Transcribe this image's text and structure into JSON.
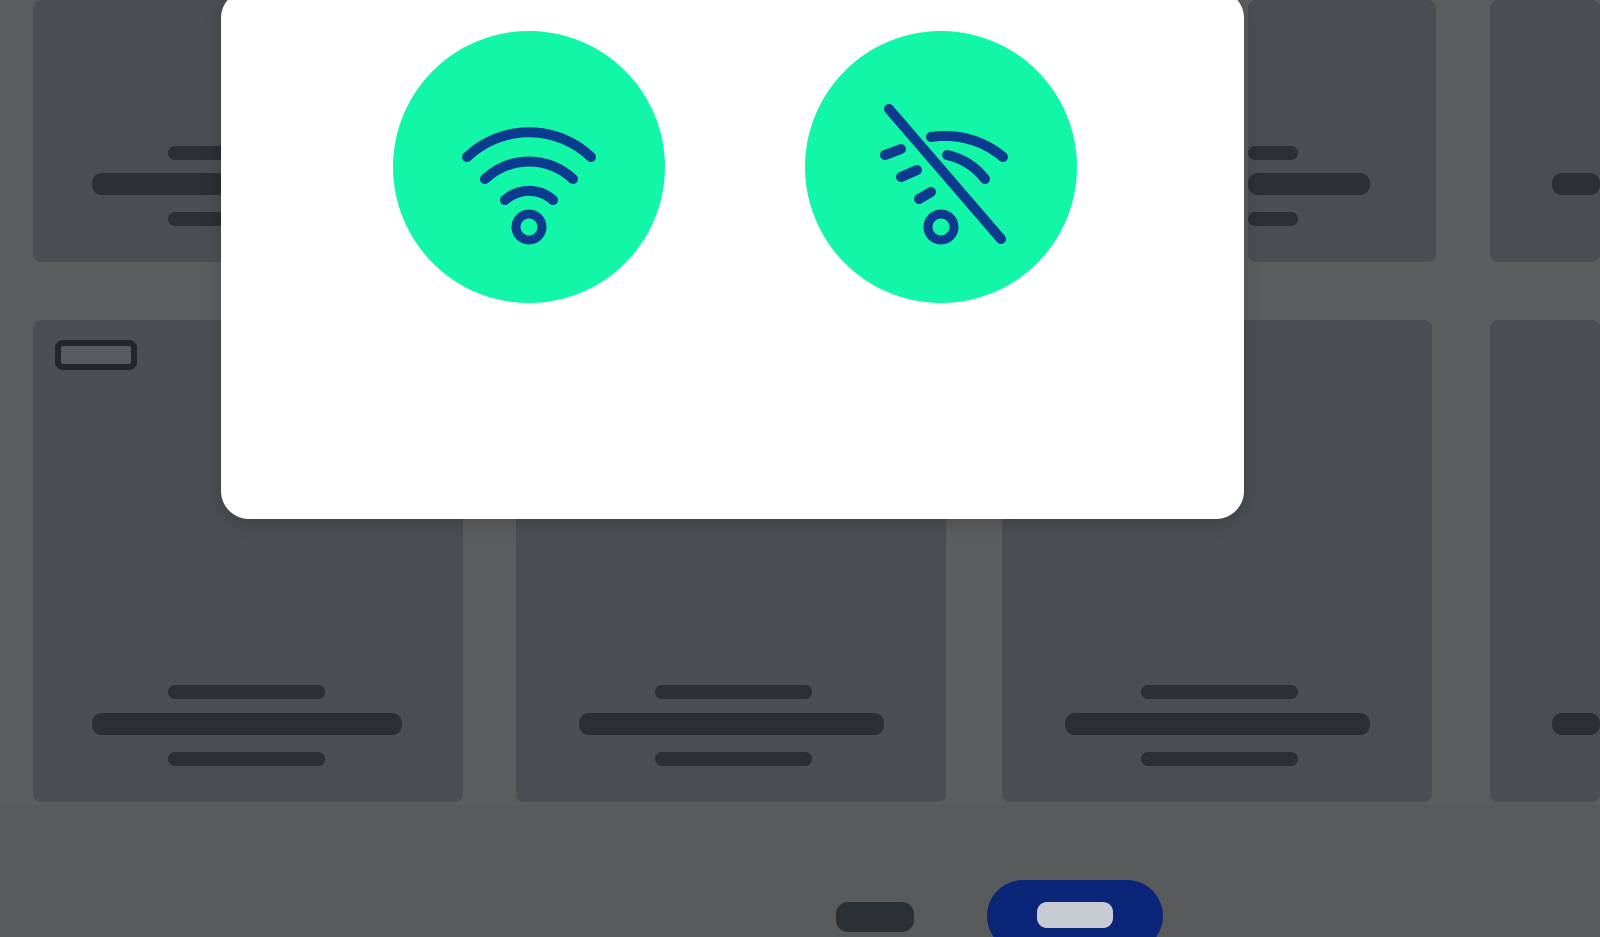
{
  "modal": {
    "options": [
      {
        "icon": "wifi-icon",
        "state": "online"
      },
      {
        "icon": "wifi-off-icon",
        "state": "offline"
      }
    ]
  },
  "pagination": {
    "total": 2,
    "active_index": 1
  },
  "colors": {
    "overlay_background": "#5c5d5f",
    "card_background": "#4b4e52",
    "placeholder_bar": "#2b3035",
    "modal_background": "#ffffff",
    "option_background": "#12f6a7",
    "icon_stroke": "#0b3a8f",
    "pager_active": "#0b2579"
  }
}
